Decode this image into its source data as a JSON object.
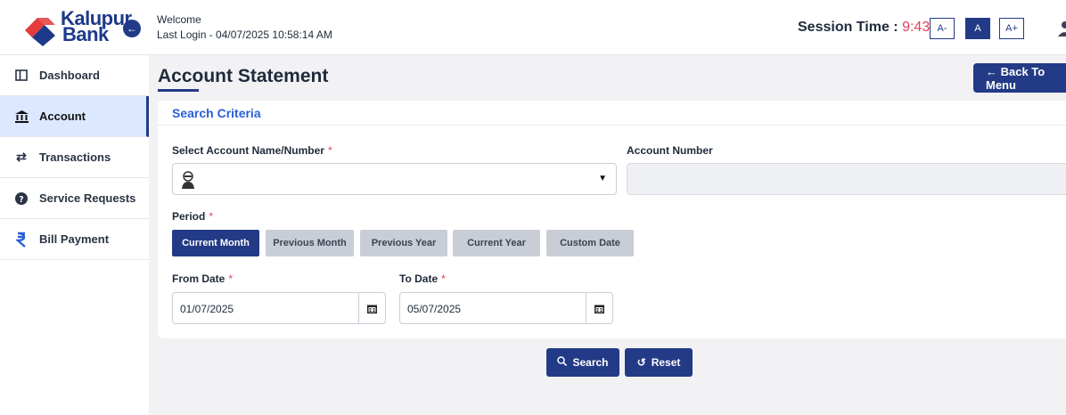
{
  "header": {
    "brand_line1": "Kalupur",
    "brand_line2": "Bank",
    "welcome": "Welcome",
    "last_login": "Last Login - 04/07/2025 10:58:14 AM",
    "session_label": "Session Time : ",
    "session_time": "9:43",
    "font_sizes": [
      "A-",
      "A",
      "A+"
    ],
    "active_font": "A"
  },
  "sidebar": {
    "items": [
      {
        "label": "Dashboard",
        "icon": "dashboard-icon"
      },
      {
        "label": "Account",
        "icon": "bank-icon",
        "active": true
      },
      {
        "label": "Transactions",
        "icon": "transfer-icon"
      },
      {
        "label": "Service Requests",
        "icon": "help-icon"
      },
      {
        "label": "Bill Payment",
        "icon": "rupee-icon"
      }
    ]
  },
  "main": {
    "title": "Account Statement",
    "back_label": "← Back To Menu",
    "section_title": "Search Criteria",
    "select_label": "Select Account Name/Number",
    "required_mark": "*",
    "account_number_label": "Account Number",
    "period_label": "Period",
    "periods": [
      "Current Month",
      "Previous Month",
      "Previous Year",
      "Current Year",
      "Custom Date"
    ],
    "active_period": "Current Month",
    "from_date_label": "From Date",
    "from_date": "01/07/2025",
    "to_date_label": "To Date",
    "to_date": "05/07/2025",
    "search_label": "Search",
    "reset_label": "Reset"
  },
  "colors": {
    "primary": "#233a86",
    "accent_red": "#e33d59",
    "link_blue": "#2a5fd6",
    "active_nav_bg": "#dbe8ff"
  }
}
